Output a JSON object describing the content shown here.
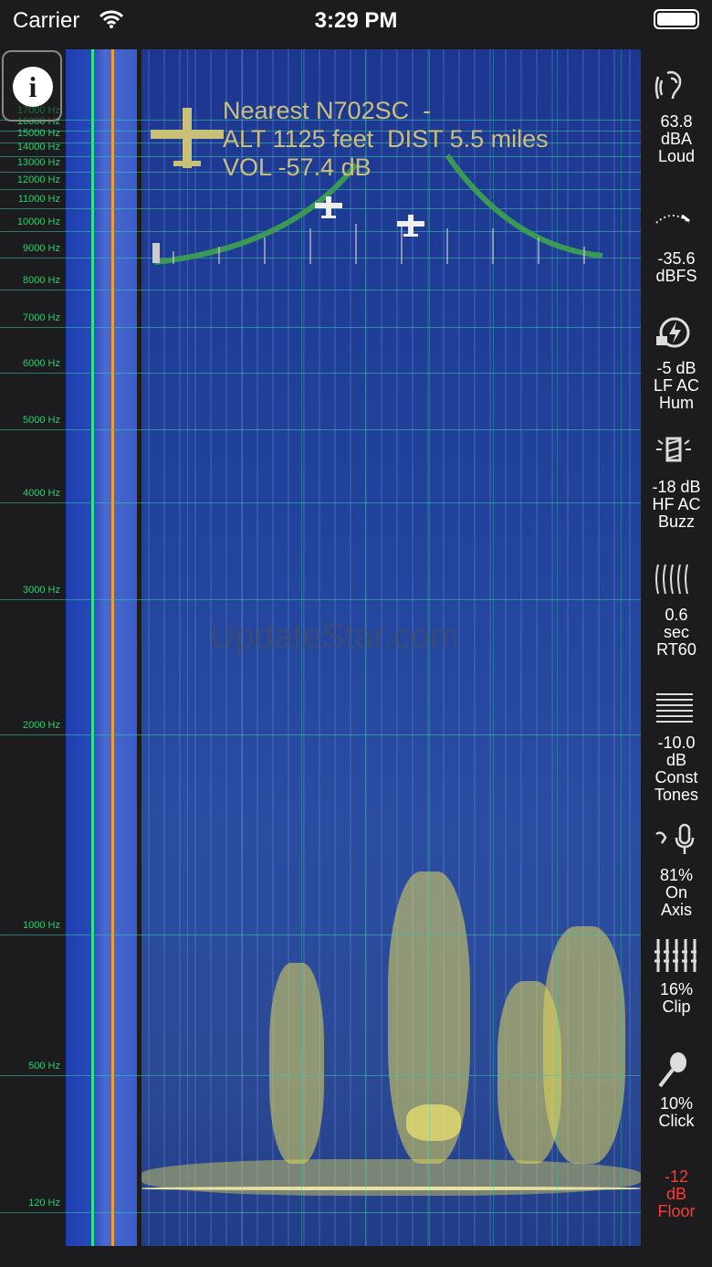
{
  "status_bar": {
    "carrier": "Carrier",
    "time": "3:29 PM"
  },
  "freq_labels": [
    "17000 Hz",
    "16000 Hz",
    "15000 Hz",
    "14000 Hz",
    "13000 Hz",
    "12000 Hz",
    "11000 Hz",
    "10000 Hz",
    "9000 Hz",
    "8000 Hz",
    "7000 Hz",
    "6000 Hz",
    "5000 Hz",
    "4000 Hz",
    "3000 Hz",
    "2000 Hz",
    "1000 Hz",
    "500 Hz",
    "120 Hz"
  ],
  "aircraft": {
    "line1": "Nearest N702SC  -",
    "line2": "ALT 1125 feet  DIST 5.5 miles",
    "line3": "VOL -57.4 dB"
  },
  "watermark": "UpdateStar.com",
  "sidebar": [
    {
      "icon": "ear-icon",
      "lines": [
        "63.8",
        "dBA",
        "Loud"
      ]
    },
    {
      "icon": "meter-icon",
      "lines": [
        "-35.6",
        "dBFS"
      ]
    },
    {
      "icon": "plug-lightning-icon",
      "lines": [
        "-5 dB",
        "LF AC",
        "Hum"
      ]
    },
    {
      "icon": "bulb-icon",
      "lines": [
        "-18 dB",
        "HF AC",
        "Buzz"
      ]
    },
    {
      "icon": "reverb-icon",
      "lines": [
        "0.6",
        "sec",
        "RT60"
      ]
    },
    {
      "icon": "lines-icon",
      "lines": [
        "-10.0",
        "dB",
        "Const",
        "Tones"
      ]
    },
    {
      "icon": "speaker-mic-icon",
      "lines": [
        "81%",
        "On",
        "Axis"
      ]
    },
    {
      "icon": "clip-icon",
      "lines": [
        "16%",
        "Clip"
      ]
    },
    {
      "icon": "maraca-icon",
      "lines": [
        "10%",
        "Click"
      ]
    },
    {
      "icon": "floor-icon",
      "lines": [
        "-12",
        "dB",
        "Floor"
      ]
    }
  ],
  "colors": {
    "grid": "#2ecc71",
    "floor": "#ff3b30",
    "plane": "#c9c07a"
  }
}
